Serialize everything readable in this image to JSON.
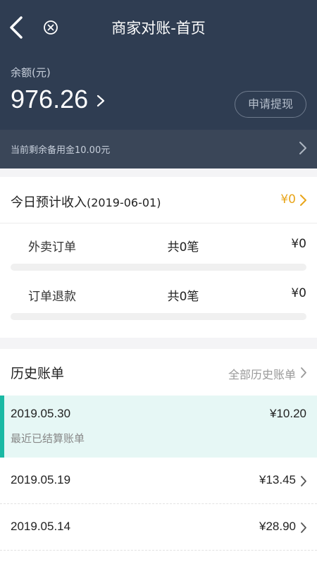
{
  "header": {
    "title": "商家对账-首页",
    "back_icon": "chevron-left-icon",
    "close_icon": "close-circle-icon"
  },
  "balance": {
    "label": "余额(元)",
    "amount": "976.26",
    "withdraw_label": "申请提现"
  },
  "reserve": {
    "text": "当前剩余备用金10.00元"
  },
  "today": {
    "title": "今日预计收入",
    "date": "(2019-06-01)",
    "amount": "¥0",
    "rows": [
      {
        "label": "外卖订单",
        "count": "共0笔",
        "amount": "¥0"
      },
      {
        "label": "订单退款",
        "count": "共0笔",
        "amount": "¥0"
      }
    ]
  },
  "history": {
    "title": "历史账单",
    "all_label": "全部历史账单",
    "bills": [
      {
        "date": "2019.05.30",
        "amount": "¥10.20",
        "subtitle": "最近已结算账单"
      },
      {
        "date": "2019.05.19",
        "amount": "¥13.45"
      },
      {
        "date": "2019.05.14",
        "amount": "¥28.90"
      }
    ]
  },
  "colors": {
    "header": "#2f3d52",
    "accent": "#1ab9a4",
    "today_amount": "#e8a51a"
  }
}
